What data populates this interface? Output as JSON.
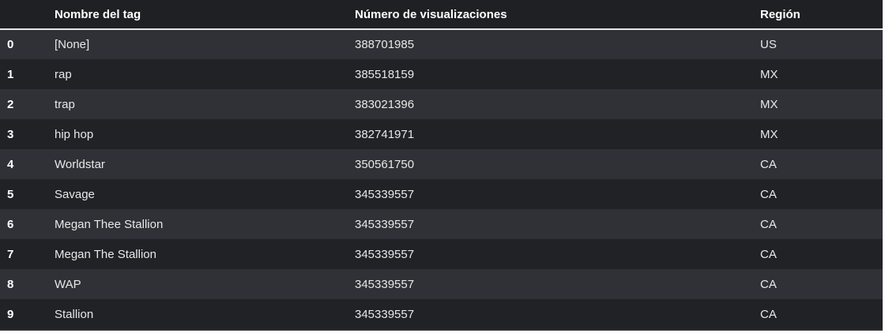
{
  "table": {
    "columns": {
      "index": "",
      "tag": "Nombre del tag",
      "views": "Número de visualizaciones",
      "region": "Región"
    },
    "rows": [
      {
        "index": "0",
        "tag": "[None]",
        "views": "388701985",
        "region": "US"
      },
      {
        "index": "1",
        "tag": "rap",
        "views": "385518159",
        "region": "MX"
      },
      {
        "index": "2",
        "tag": "trap",
        "views": "383021396",
        "region": "MX"
      },
      {
        "index": "3",
        "tag": "hip hop",
        "views": "382741971",
        "region": "MX"
      },
      {
        "index": "4",
        "tag": "Worldstar",
        "views": "350561750",
        "region": "CA"
      },
      {
        "index": "5",
        "tag": "Savage",
        "views": "345339557",
        "region": "CA"
      },
      {
        "index": "6",
        "tag": "Megan Thee Stallion",
        "views": "345339557",
        "region": "CA"
      },
      {
        "index": "7",
        "tag": "Megan The Stallion",
        "views": "345339557",
        "region": "CA"
      },
      {
        "index": "8",
        "tag": "WAP",
        "views": "345339557",
        "region": "CA"
      },
      {
        "index": "9",
        "tag": "Stallion",
        "views": "345339557",
        "region": "CA"
      }
    ]
  },
  "colors": {
    "background": "#2b2d31",
    "header_background": "#1f2023",
    "row_odd": "#2f3136",
    "row_even": "#212226",
    "text": "#e8e8e8",
    "header_rule": "#e6e6e6"
  }
}
